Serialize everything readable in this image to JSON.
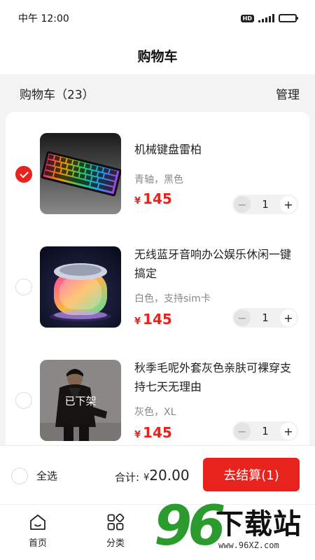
{
  "status_bar": {
    "time": "中午 12:00",
    "hd_badge": "HD"
  },
  "header": {
    "title": "购物车"
  },
  "subheader": {
    "cart_count": "购物车（23）",
    "manage_label": "管理"
  },
  "items": [
    {
      "name": "机械键盘雷柏",
      "spec": "青轴，黑色",
      "currency": "¥",
      "price": "145",
      "qty": "1",
      "checked": true,
      "image": "rgb-mechanical-keyboard"
    },
    {
      "name": "无线蓝牙音响办公娱乐休闲一键搞定",
      "spec": "白色，支持sim卡",
      "currency": "¥",
      "price": "145",
      "qty": "1",
      "checked": false,
      "image": "glowing-bluetooth-speaker"
    },
    {
      "name": "秋季毛呢外套灰色亲肤可裸穿支持七天无理由",
      "spec": "灰色，XL",
      "currency": "¥",
      "price": "145",
      "qty": "1",
      "checked": false,
      "image": "man-in-dark-coat",
      "overlay": "已下架"
    }
  ],
  "stepper": {
    "minus": "−",
    "plus": "+"
  },
  "checkout": {
    "select_all_label": "全选",
    "total_label": "合计:",
    "currency": "¥",
    "total_value": "20.00",
    "pay_button_label": "去结算(1)"
  },
  "tabbar": {
    "items": [
      {
        "label": "首页",
        "icon": "home-icon"
      },
      {
        "label": "分类",
        "icon": "category-icon"
      }
    ]
  },
  "watermark": {
    "digits": "96",
    "text": "下载站",
    "url": "www.96XZ.com"
  },
  "colors": {
    "accent": "#e8231d",
    "watermark_green": "#2c9b2e"
  }
}
